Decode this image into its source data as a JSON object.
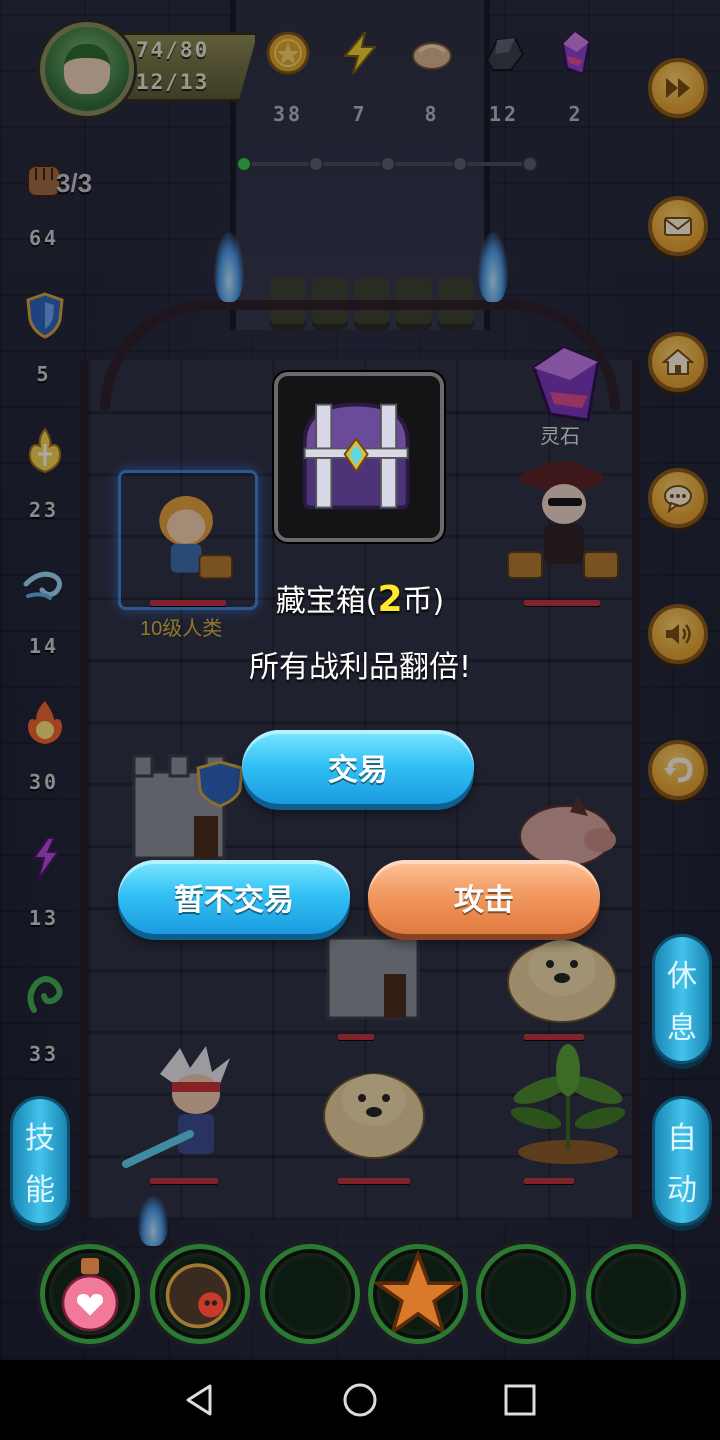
{
  "hud": {
    "hp": "74/80",
    "level_progress": "12/13",
    "fist_count": "3/3",
    "resources": [
      {
        "icon": "gold-coin-icon",
        "value": "38"
      },
      {
        "icon": "lightning-icon",
        "value": "7"
      },
      {
        "icon": "bread-icon",
        "value": "8"
      },
      {
        "icon": "ore-icon",
        "value": "12"
      },
      {
        "icon": "crystal-icon",
        "value": "2"
      }
    ],
    "stage_dots_active": 1
  },
  "stats": {
    "attack": "64",
    "defense": "5",
    "holy": "23",
    "wind": "14",
    "fire": "30",
    "dark": "13",
    "poison": "33"
  },
  "board": {
    "player_label": "10级人类",
    "spirit_stone_label": "灵石"
  },
  "dialog": {
    "item_name": "藏宝箱(",
    "item_price": "2",
    "item_unit": "币)",
    "description": "所有战利品翻倍!",
    "trade_button": "交易",
    "decline_button": "暂不交易",
    "attack_button": "攻击"
  },
  "side": {
    "skills_top": "技",
    "skills_bottom": "能",
    "rest_top": "休",
    "rest_bottom": "息",
    "auto_top": "自",
    "auto_bottom": "动"
  },
  "colors": {
    "accent_blue": "#34c2f5",
    "accent_orange": "#f29a62",
    "highlight_yellow": "#ffe92e",
    "hp_red": "#c3323a"
  }
}
